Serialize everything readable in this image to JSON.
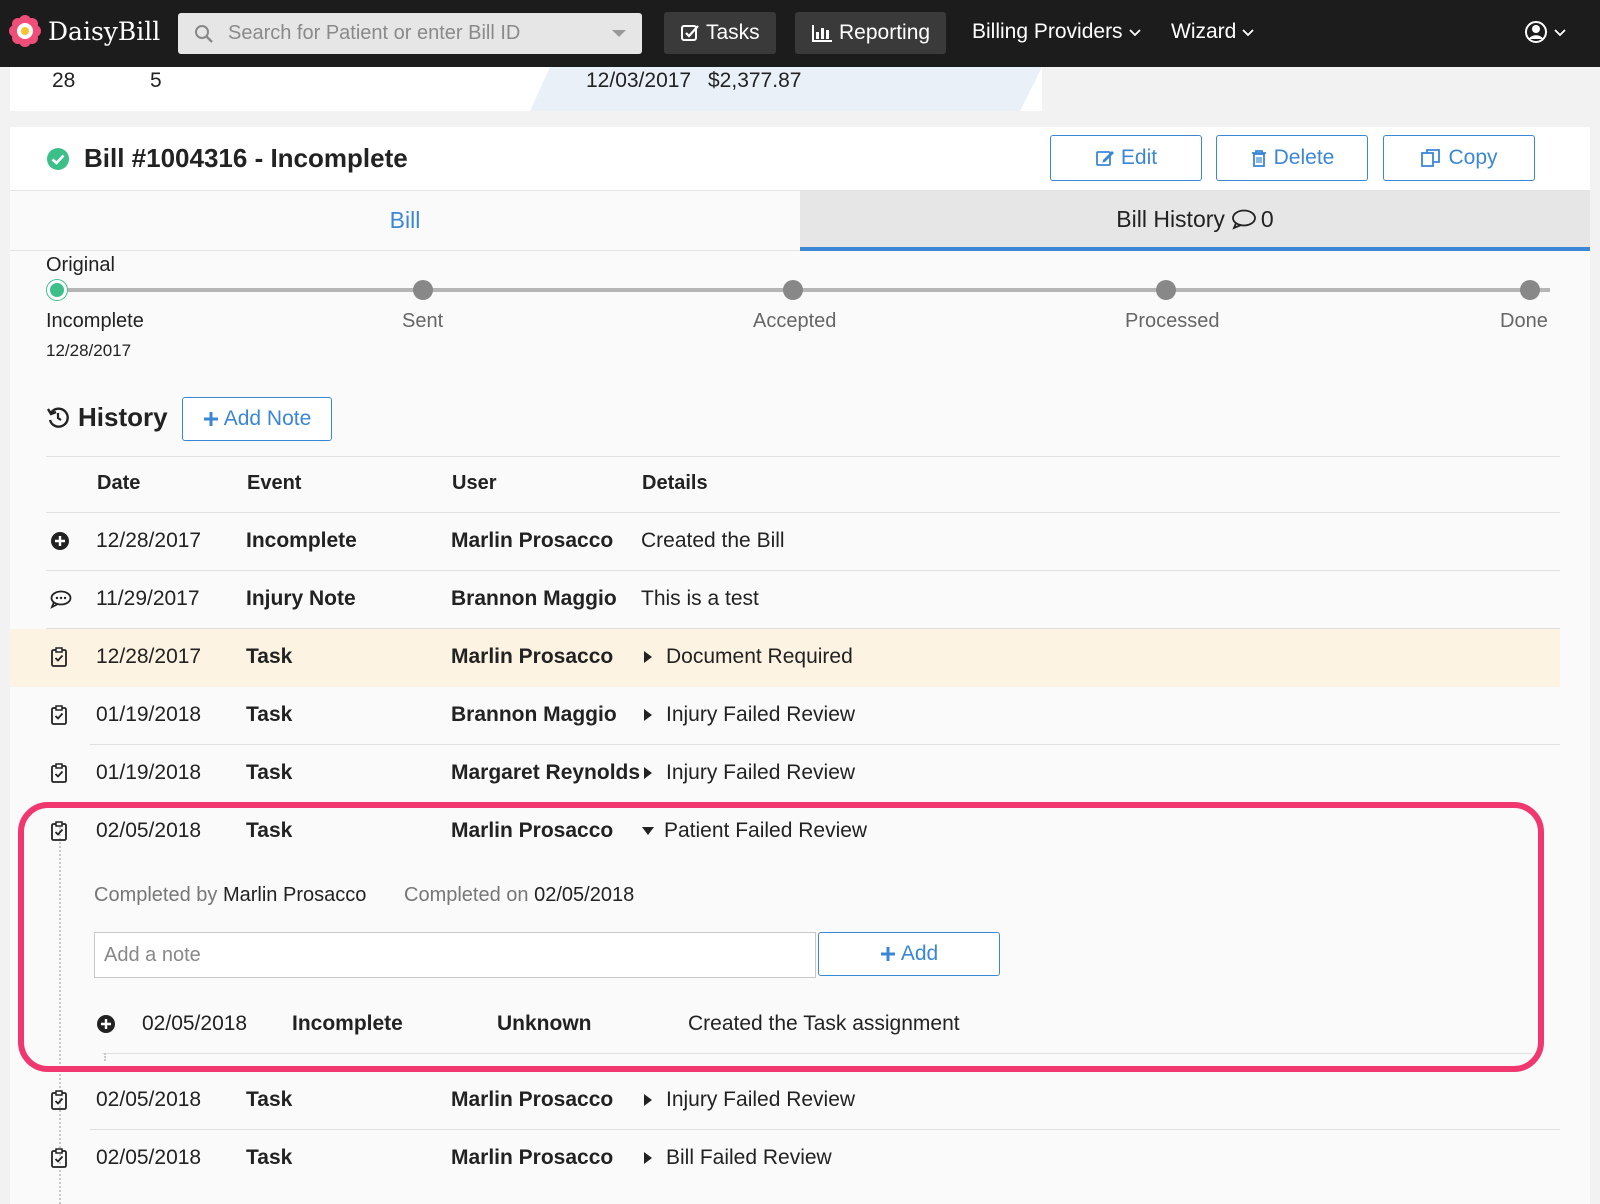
{
  "nav": {
    "brand": "DaisyBill",
    "search_placeholder": "Search for Patient or enter Bill ID",
    "tasks_label": "Tasks",
    "reporting_label": "Reporting",
    "billing_providers_label": "Billing Providers",
    "wizard_label": "Wizard"
  },
  "summary_strip": {
    "col1": "28",
    "col2": "5",
    "date": "12/03/2017",
    "amount": "$2,377.87"
  },
  "bill": {
    "title": "Bill #1004316 - Incomplete",
    "edit_label": "Edit",
    "delete_label": "Delete",
    "copy_label": "Copy",
    "status_color": "#3cc08a"
  },
  "tabs": {
    "bill": "Bill",
    "history": "Bill History",
    "history_count": "0"
  },
  "progress": {
    "version_label": "Original",
    "current_date": "12/28/2017",
    "stages": [
      "Incomplete",
      "Sent",
      "Accepted",
      "Processed",
      "Done"
    ],
    "completed_stages": 1
  },
  "history": {
    "title": "History",
    "add_note_label": "Add Note",
    "columns": [
      "Date",
      "Event",
      "User",
      "Details"
    ],
    "rows": [
      {
        "icon": "plus-circle-icon",
        "date": "12/28/2017",
        "event": "Incomplete",
        "user": "Marlin Prosacco",
        "details": "Created the Bill"
      },
      {
        "icon": "comment-icon",
        "date": "11/29/2017",
        "event": "Injury Note",
        "user": "Brannon Maggio",
        "details": "This is a test"
      },
      {
        "icon": "task-icon",
        "date": "12/28/2017",
        "event": "Task",
        "user": "Marlin Prosacco",
        "details": "Document Required"
      },
      {
        "icon": "task-icon",
        "date": "01/19/2018",
        "event": "Task",
        "user": "Brannon Maggio",
        "details": "Injury Failed Review"
      },
      {
        "icon": "task-icon",
        "date": "01/19/2018",
        "event": "Task",
        "user": "Margaret Reynolds",
        "details": "Injury Failed Review"
      },
      {
        "icon": "task-icon",
        "date": "02/05/2018",
        "event": "Task",
        "user": "Marlin Prosacco",
        "details": "Patient Failed Review"
      },
      {
        "icon": "task-icon",
        "date": "02/05/2018",
        "event": "Task",
        "user": "Marlin Prosacco",
        "details": "Injury Failed Review"
      },
      {
        "icon": "task-icon",
        "date": "02/05/2018",
        "event": "Task",
        "user": "Marlin Prosacco",
        "details": "Bill Failed Review"
      }
    ],
    "expanded": {
      "completed_by_label": "Completed by",
      "completed_by": "Marlin Prosacco",
      "completed_on_label": "Completed on",
      "completed_on": "02/05/2018",
      "note_placeholder": "Add a note",
      "add_label": "Add",
      "sub_row": {
        "icon": "plus-circle-icon",
        "date": "02/05/2018",
        "event": "Incomplete",
        "user": "Unknown",
        "details": "Created the Task assignment"
      }
    }
  },
  "colors": {
    "accent": "#3b87d6",
    "highlight_row": "#fdf3e2",
    "annotation": "#f0376f"
  }
}
